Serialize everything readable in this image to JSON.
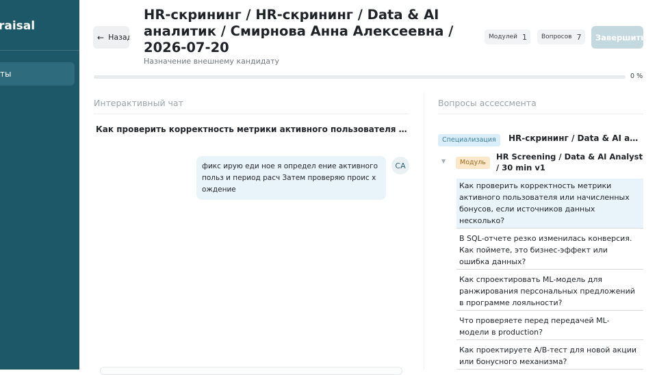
{
  "sidebar": {
    "brand": "raisal",
    "active_item": "ты"
  },
  "header": {
    "back_label": "Назад",
    "title": "HR-скрининг / HR-скрининг / Data & AI аналитик / Смирнова Анна Алексеевна / 2026-07-20",
    "subtitle": "Назначение внешнему кандидату",
    "modules_label": "Модулей",
    "modules_count": "1",
    "questions_label": "Вопросов",
    "questions_count": "7",
    "finish_label": "Завершить",
    "progress_value": 0,
    "progress_text": "0 %"
  },
  "chat": {
    "heading": "Интерактивный чат",
    "question": "Как проверить корректность метрики активного пользователя и...",
    "message": "фикс ирую еди ное я определ ение активного польз и период расч Затем проверяю проис х ождение",
    "avatar": "CA"
  },
  "assessment": {
    "heading": "Вопросы ассессмента",
    "spec_badge": "Специализация",
    "spec_name": "HR-скрининг / Data & AI аналитик",
    "module_badge": "Модуль",
    "module_name": "HR Screening / Data & AI Analyst / 30 min v1",
    "questions": [
      "Как проверить корректность метрики активного пользователя или начисленных бонусов, если источников данных несколько?",
      "В SQL-отчете резко изменилась конверсия. Как поймете, это бизнес-эффект или ошибка данных?",
      "Как спроектировать ML-модель для ранжирования персональных предложений в программе лояльности?",
      "Что проверяете перед передачей ML-модели в production?",
      "Как проектируете A/B-тест для новой акции или бонусного механизма?"
    ]
  },
  "colors": {
    "sidebar": "#1d5868",
    "accent_light": "#e9f4fa",
    "finish_disabled": "#c4d9df"
  }
}
